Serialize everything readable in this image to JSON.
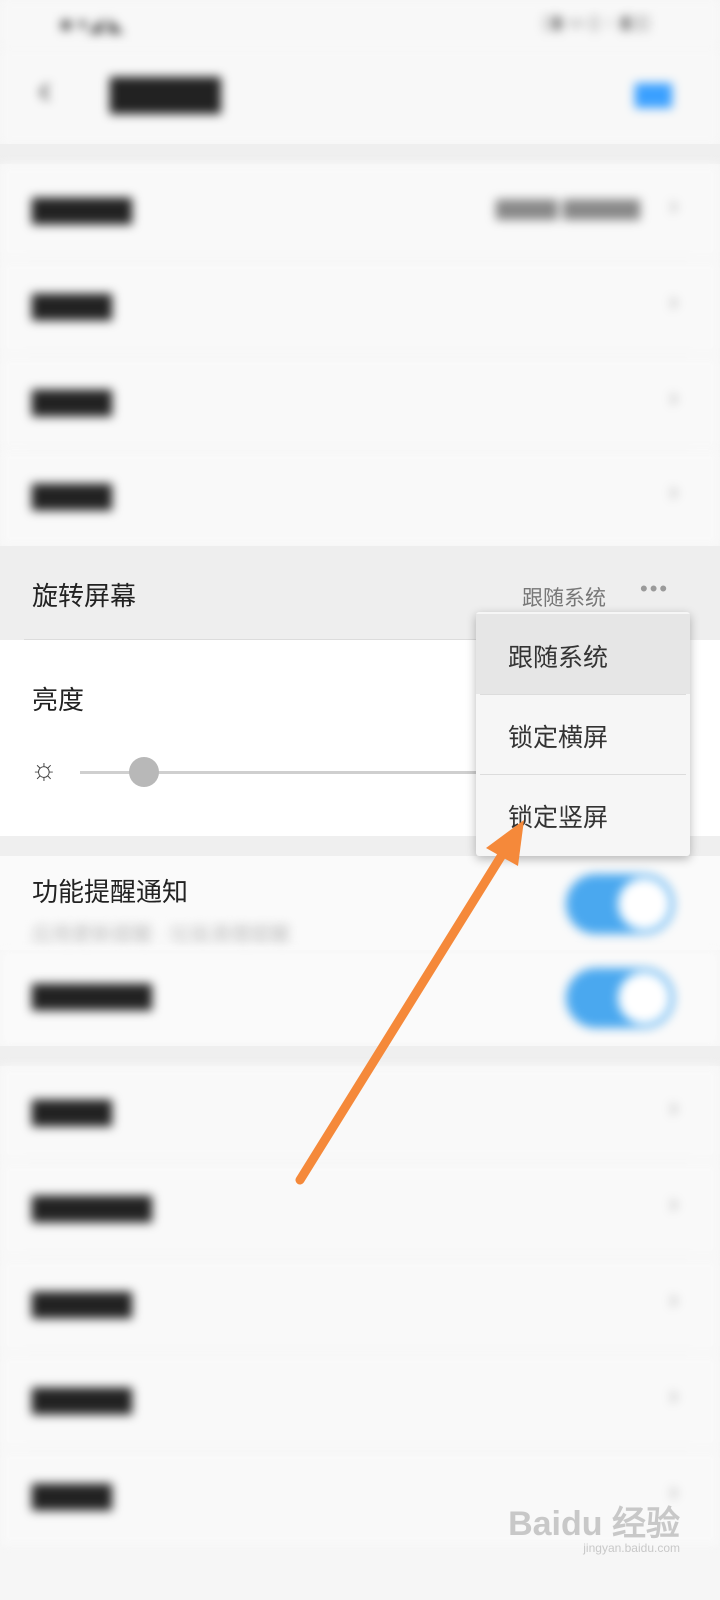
{
  "status": {
    "left": "■ ▾◢ ◣",
    "right": "▯▮ ▭ ▯ ◌ ▮▯▯"
  },
  "header": {
    "back_icon": "back-arrow-icon",
    "title": "▇▇▇▇",
    "action": "▇▇"
  },
  "top_rows": [
    {
      "label": "▇▇▇▇▇",
      "value": "▇▇▇▇ ▇▇▇▇▇"
    },
    {
      "label": "▇▇▇▇"
    },
    {
      "label": "▇▇▇▇"
    },
    {
      "label": "▇▇▇▇"
    }
  ],
  "rotate": {
    "label": "旋转屏幕",
    "value": "跟随系统",
    "more": "•••"
  },
  "brightness": {
    "label": "亮度",
    "icon": "sun-icon",
    "level": 0.16
  },
  "dropdown": {
    "options": [
      "跟随系统",
      "锁定横屏",
      "锁定竖屏"
    ],
    "selected_index": 0
  },
  "notify": {
    "label": "功能提醒通知",
    "sub": "应用更新提醒 · 垃圾清理提醒",
    "toggle_on": true
  },
  "notify2": {
    "label": "▇▇▇▇▇▇",
    "toggle_on": true
  },
  "bottom_rows": [
    {
      "label": "▇▇▇▇"
    },
    {
      "label": "▇▇▇▇▇▇"
    },
    {
      "label": "▇▇▇▇▇"
    },
    {
      "label": "▇▇▇▇▇"
    },
    {
      "label": "▇▇▇▇"
    }
  ],
  "colors": {
    "accent": "#4aa8ef",
    "arrow": "#f5893a"
  },
  "watermark": {
    "logo": "Baidu 经验",
    "url": "jingyan.baidu.com"
  }
}
